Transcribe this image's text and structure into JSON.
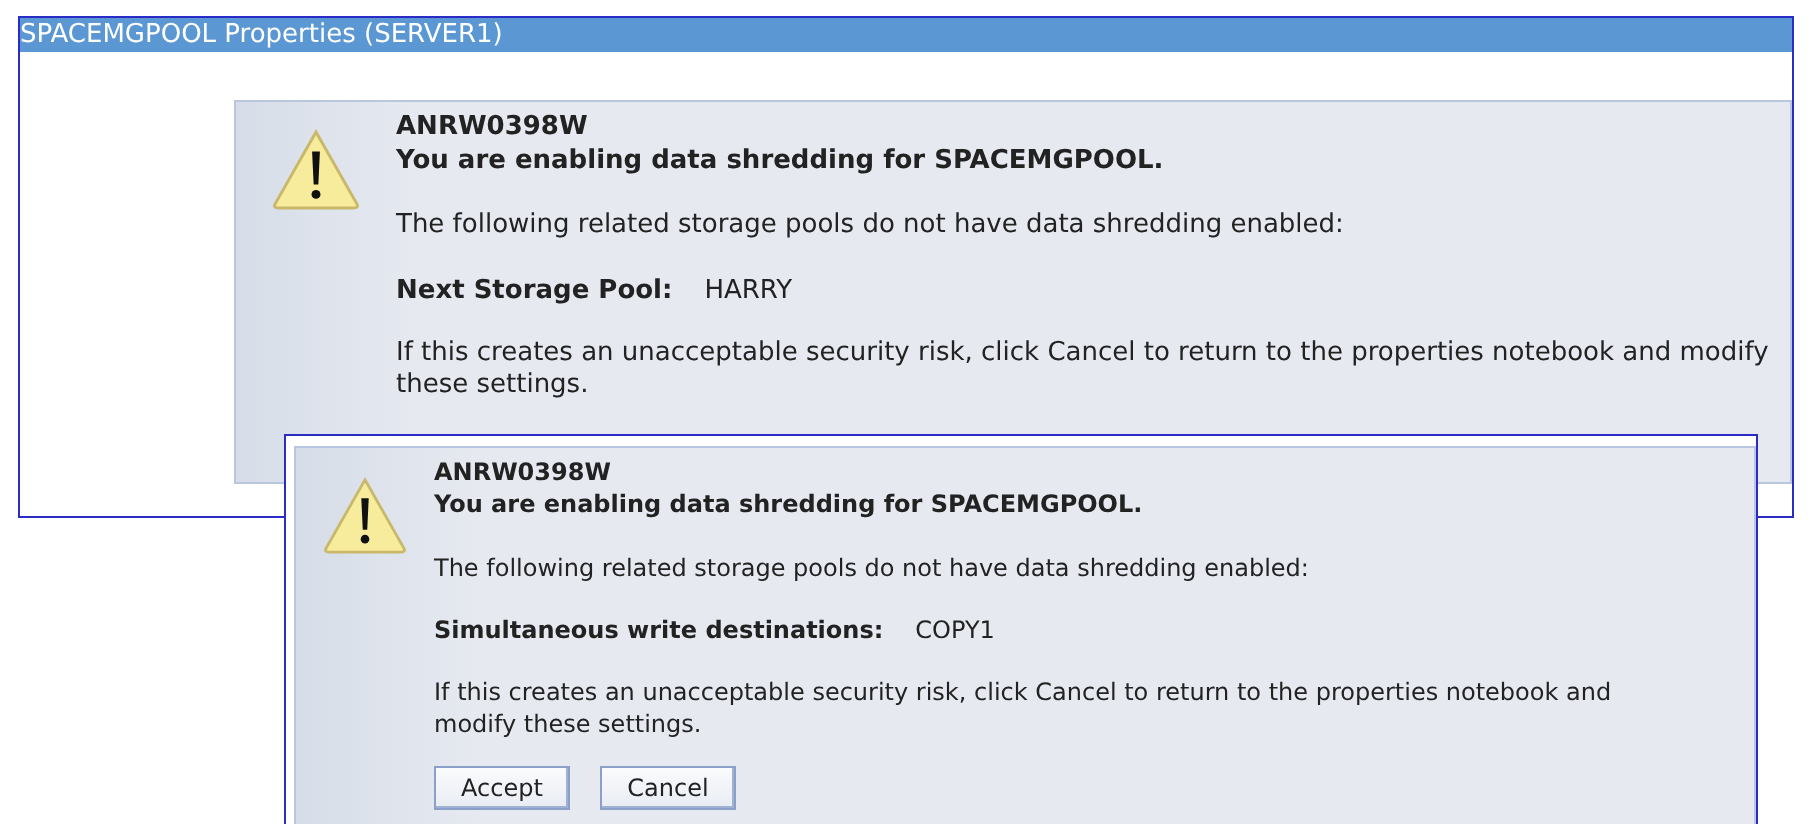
{
  "window": {
    "title": "SPACEMGPOOL Properties (SERVER1)"
  },
  "dialogs": [
    {
      "code": "ANRW0398W",
      "heading": "You are enabling data shredding for SPACEMGPOOL.",
      "intro": "The following related storage pools do not have data shredding enabled:",
      "field_label": "Next Storage Pool:",
      "field_value": "HARRY",
      "advice": "If this creates an unacceptable security risk, click Cancel to return to the properties notebook and modify these settings."
    },
    {
      "code": "ANRW0398W",
      "heading": "You are enabling data shredding for SPACEMGPOOL.",
      "intro": "The following related storage pools do not have data shredding enabled:",
      "field_label": "Simultaneous write destinations:",
      "field_value": "COPY1",
      "advice": "If this creates an unacceptable security risk, click Cancel to return to the properties notebook and modify these settings.",
      "buttons": [
        "Accept",
        "Cancel"
      ]
    }
  ]
}
